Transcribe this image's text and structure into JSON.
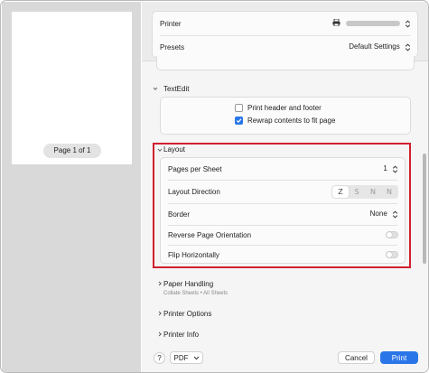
{
  "preview": {
    "page_label": "Page 1 of 1"
  },
  "printer": {
    "label": "Printer"
  },
  "presets": {
    "label": "Presets",
    "value": "Default Settings"
  },
  "textedit": {
    "title": "TextEdit",
    "print_header_footer": {
      "label": "Print header and footer",
      "checked": false
    },
    "rewrap": {
      "label": "Rewrap contents to fit page",
      "checked": true
    }
  },
  "layout": {
    "title": "Layout",
    "pages_per_sheet": {
      "label": "Pages per Sheet",
      "value": "1"
    },
    "layout_direction": {
      "label": "Layout Direction",
      "options": [
        "Z",
        "S",
        "N",
        "N"
      ]
    },
    "border": {
      "label": "Border",
      "value": "None"
    },
    "reverse_orientation": {
      "label": "Reverse Page Orientation",
      "on": false
    },
    "flip_horizontally": {
      "label": "Flip Horizontally",
      "on": false
    }
  },
  "paper_handling": {
    "title": "Paper Handling",
    "subtitle": "Collate Sheets • All Sheets"
  },
  "printer_options": {
    "title": "Printer Options"
  },
  "printer_info": {
    "title": "Printer Info"
  },
  "footer": {
    "help": "?",
    "pdf": "PDF",
    "cancel": "Cancel",
    "print": "Print"
  },
  "colors": {
    "accent": "#2a76e9",
    "highlight": "#d0202e"
  }
}
